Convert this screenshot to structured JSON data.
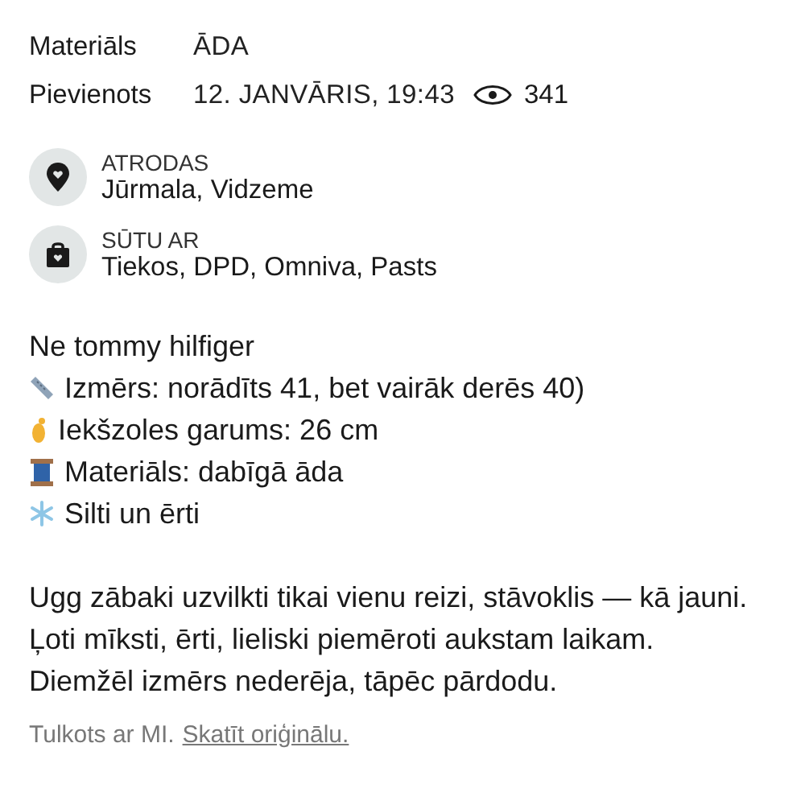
{
  "details": [
    {
      "label": "Materiāls",
      "value": "ĀDA"
    },
    {
      "label": "Pievienots",
      "value": "12. JANVĀRIS, 19:43",
      "views": "341"
    }
  ],
  "info": [
    {
      "kind": "location",
      "title": "ATRODAS",
      "value": "Jūrmala, Vidzeme"
    },
    {
      "kind": "shipping",
      "title": "SŪTU AR",
      "value": "Tiekos, DPD, Omniva, Pasts"
    }
  ],
  "description": {
    "title": "Ne tommy hilfiger",
    "bullets": [
      {
        "kind": "ruler",
        "text": "Izmērs: norādīts 41, bet vairāk derēs 40)"
      },
      {
        "kind": "foot",
        "text": "Iekšzoles garums: 26 cm"
      },
      {
        "kind": "spool",
        "text": "Materiāls: dabīgā āda"
      },
      {
        "kind": "snowflake",
        "text": "Silti un ērti"
      }
    ],
    "paragraph": "Ugg zābaki uzvilkti tikai vienu reizi, stāvoklis — kā jauni.\nĻoti mīksti, ērti, lieliski piemēroti aukstam laikam.\nDiemžēl izmērs nederēja, tāpēc pārdodu."
  },
  "translation": {
    "note": "Tulkots ar MI.",
    "link": "Skatīt oriģinālu."
  }
}
